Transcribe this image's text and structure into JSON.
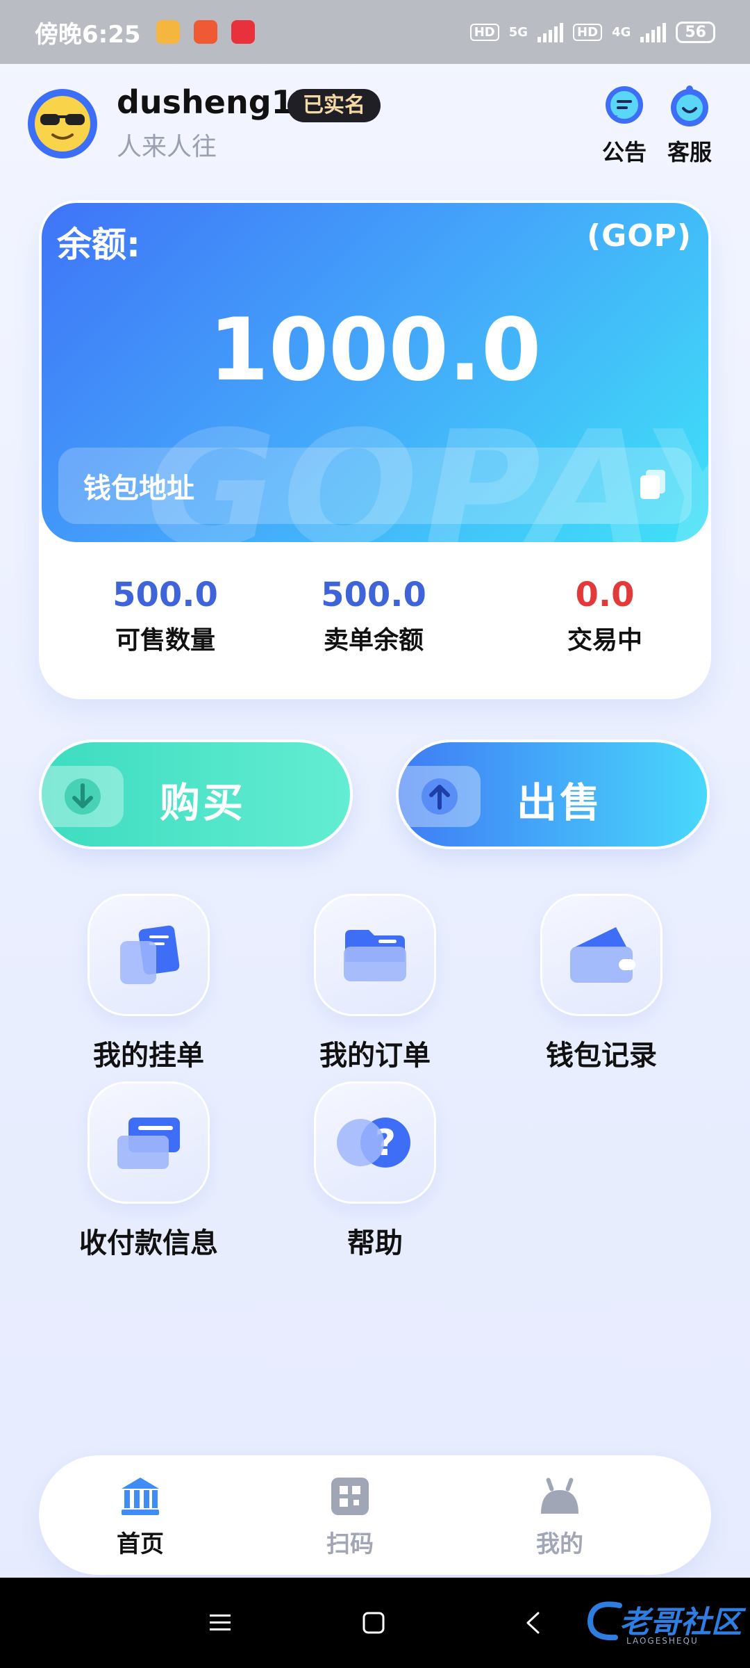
{
  "status_bar": {
    "time": "傍晚6:25",
    "hd1": "HD",
    "net1": "5G",
    "hd2": "HD",
    "net2": "4G",
    "battery": "56"
  },
  "header": {
    "username": "dusheng12",
    "verified_badge": "已实名",
    "nickname": "人来人往",
    "notice_label": "公告",
    "service_label": "客服"
  },
  "balance_card": {
    "label": "余额:",
    "unit": "(GOP)",
    "amount": "1000.0",
    "watermark": "GOPAY",
    "wallet_address_prefix": "钱包地址"
  },
  "stats": [
    {
      "value": "500.0",
      "label": "可售数量",
      "color": "#3f63d9"
    },
    {
      "value": "500.0",
      "label": "卖单余额",
      "color": "#3f63d9"
    },
    {
      "value": "0.0",
      "label": "交易中",
      "color": "#e23a3a"
    }
  ],
  "actions": {
    "buy_label": "购买",
    "sell_label": "出售"
  },
  "menu": [
    {
      "label": "我的挂单",
      "icon": "listing-card-icon"
    },
    {
      "label": "我的订单",
      "icon": "folder-icon"
    },
    {
      "label": "钱包记录",
      "icon": "wallet-icon"
    },
    {
      "label": "收付款信息",
      "icon": "payment-card-icon"
    },
    {
      "label": "帮助",
      "icon": "help-icon"
    }
  ],
  "bottom_nav": [
    {
      "label": "首页",
      "icon": "bank-icon",
      "active": true
    },
    {
      "label": "扫码",
      "icon": "qr-scan-icon",
      "active": false
    },
    {
      "label": "我的",
      "icon": "profile-icon",
      "active": false
    }
  ],
  "colors": {
    "accent": "#3f6ef6",
    "buy": "#3ddcc0",
    "sell": "#3f7cf5",
    "stat_value": "#3f63d9",
    "stat_negative": "#e23a3a",
    "nav_active": "#111111",
    "nav_inactive": "#a0a6b6"
  },
  "system_bar": {
    "watermark_logo": "老哥社区",
    "watermark_sub": "LAOGESHEQU"
  }
}
